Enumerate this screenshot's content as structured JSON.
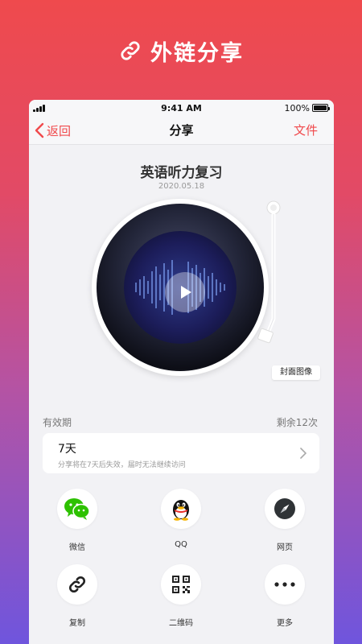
{
  "promo": {
    "title": "外链分享",
    "icon": "link-icon"
  },
  "status_bar": {
    "time": "9:41 AM",
    "battery": "100%"
  },
  "nav": {
    "back_label": "返回",
    "title": "分享",
    "right_label": "文件"
  },
  "recording": {
    "title": "英语听力复习",
    "date": "2020.05.18"
  },
  "cover_button": {
    "label": "封面图像"
  },
  "validity": {
    "label": "有效期",
    "remaining": "剩余12次",
    "value": "7天",
    "description": "分享将在7天后失效，届时无法继续访问"
  },
  "share_targets": [
    {
      "label": "微信",
      "icon": "wechat-icon",
      "color": "#2dc100"
    },
    {
      "label": "QQ",
      "icon": "qq-penguin-icon",
      "color": "#111111"
    },
    {
      "label": "网页",
      "icon": "compass-icon",
      "color": "#2f3336"
    },
    {
      "label": "复制",
      "icon": "link-icon",
      "color": "#222222"
    },
    {
      "label": "二维码",
      "icon": "qr-code-icon",
      "color": "#222222"
    },
    {
      "label": "更多",
      "icon": "more-dots-icon",
      "color": "#222222"
    }
  ],
  "colors": {
    "accent": "#f0494c",
    "background_top": "#ef4a4d",
    "background_bottom": "#6f55dd"
  }
}
